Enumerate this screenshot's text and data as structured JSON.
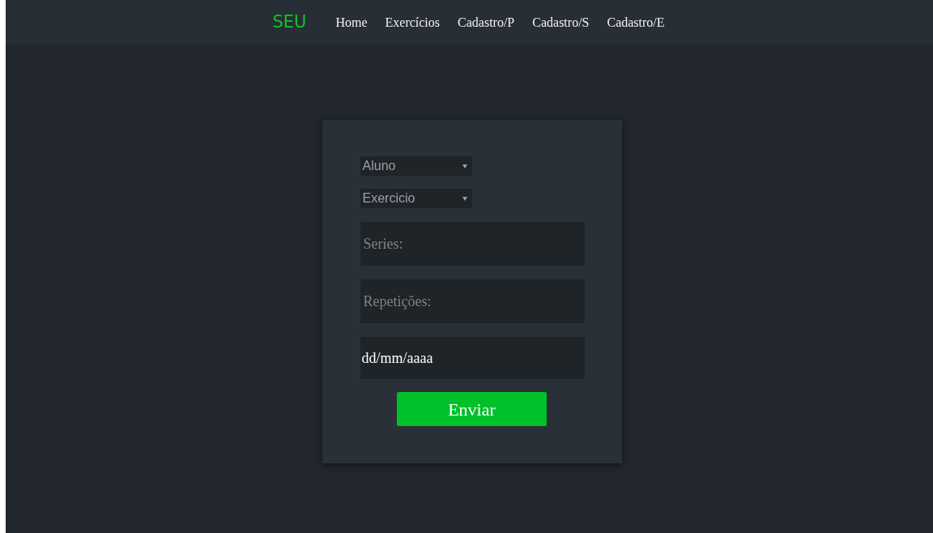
{
  "nav": {
    "brand": "SEU",
    "links": [
      "Home",
      "Exercícios",
      "Cadastro/P",
      "Cadastro/S",
      "Cadastro/E"
    ]
  },
  "form": {
    "selects": [
      {
        "label": "Aluno"
      },
      {
        "label": "Exercicio"
      }
    ],
    "fields": [
      {
        "kind": "text",
        "placeholder": "Series:"
      },
      {
        "kind": "text",
        "placeholder": "Repetições:"
      },
      {
        "kind": "date",
        "value": "dd/mm/aaaa"
      }
    ],
    "submit": "Enviar"
  }
}
